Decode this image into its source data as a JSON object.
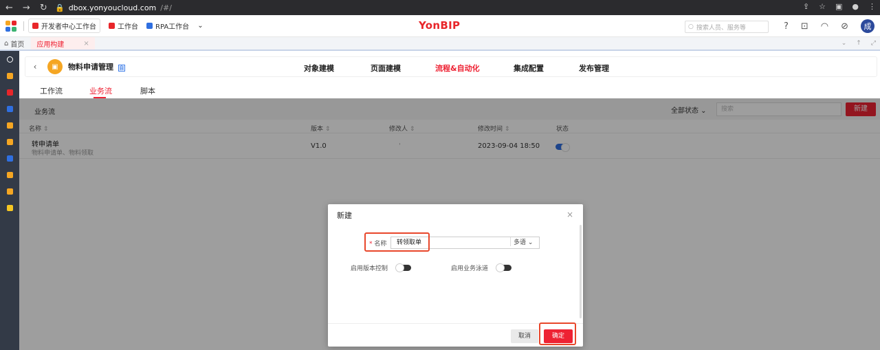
{
  "browser": {
    "url_host": "dbox.yonyoucloud.com",
    "url_path": "/#/"
  },
  "topbar": {
    "bookmarks": [
      {
        "label": "开发者中心工作台",
        "color": "#e8262a"
      },
      {
        "label": "工作台",
        "color": "#e8262a"
      },
      {
        "label": "RPA工作台",
        "color": "#2f6fe0"
      }
    ],
    "brand": "YonBIP",
    "search_placeholder": "搜索人员、服务等",
    "avatar_text": "成"
  },
  "tabstrip": {
    "home_label": "首页",
    "active_tab": "应用构建"
  },
  "leftrail": {
    "colors": [
      "#ffffff",
      "#f5a623",
      "#e8262a",
      "#2f6fe0",
      "#f5a623",
      "#f5a623",
      "#2f6fe0",
      "#f5a623",
      "#f5a623",
      "#f5c623"
    ]
  },
  "page": {
    "title": "物料申请管理",
    "title_badge": "自",
    "nav_tabs": [
      "对象建模",
      "页面建模",
      "流程&自动化",
      "集成配置",
      "发布管理"
    ],
    "active_nav": "流程&自动化",
    "sub_tabs": [
      "工作流",
      "业务流",
      "脚本"
    ],
    "active_sub": "业务流"
  },
  "list": {
    "label": "业务流",
    "status_filter": "全部状态",
    "search_placeholder": "搜索",
    "new_button": "新建",
    "columns": [
      "名称",
      "版本",
      "修改人",
      "修改时间",
      "状态"
    ],
    "rows": [
      {
        "name": "转申请单",
        "desc": "物料申请单、物料领取",
        "version": "V1.0",
        "modifier": "'",
        "time": "2023-09-04 18:50",
        "status_on": true
      }
    ]
  },
  "modal": {
    "title": "新建",
    "name_label": "名称",
    "name_value": "转领取单",
    "lang_label": "多语",
    "toggle1_label": "启用版本控制",
    "toggle2_label": "启用业务泳道",
    "cancel": "取消",
    "ok": "确定"
  },
  "colors": {
    "accent": "#e8262a",
    "blue": "#2f6fe0"
  }
}
